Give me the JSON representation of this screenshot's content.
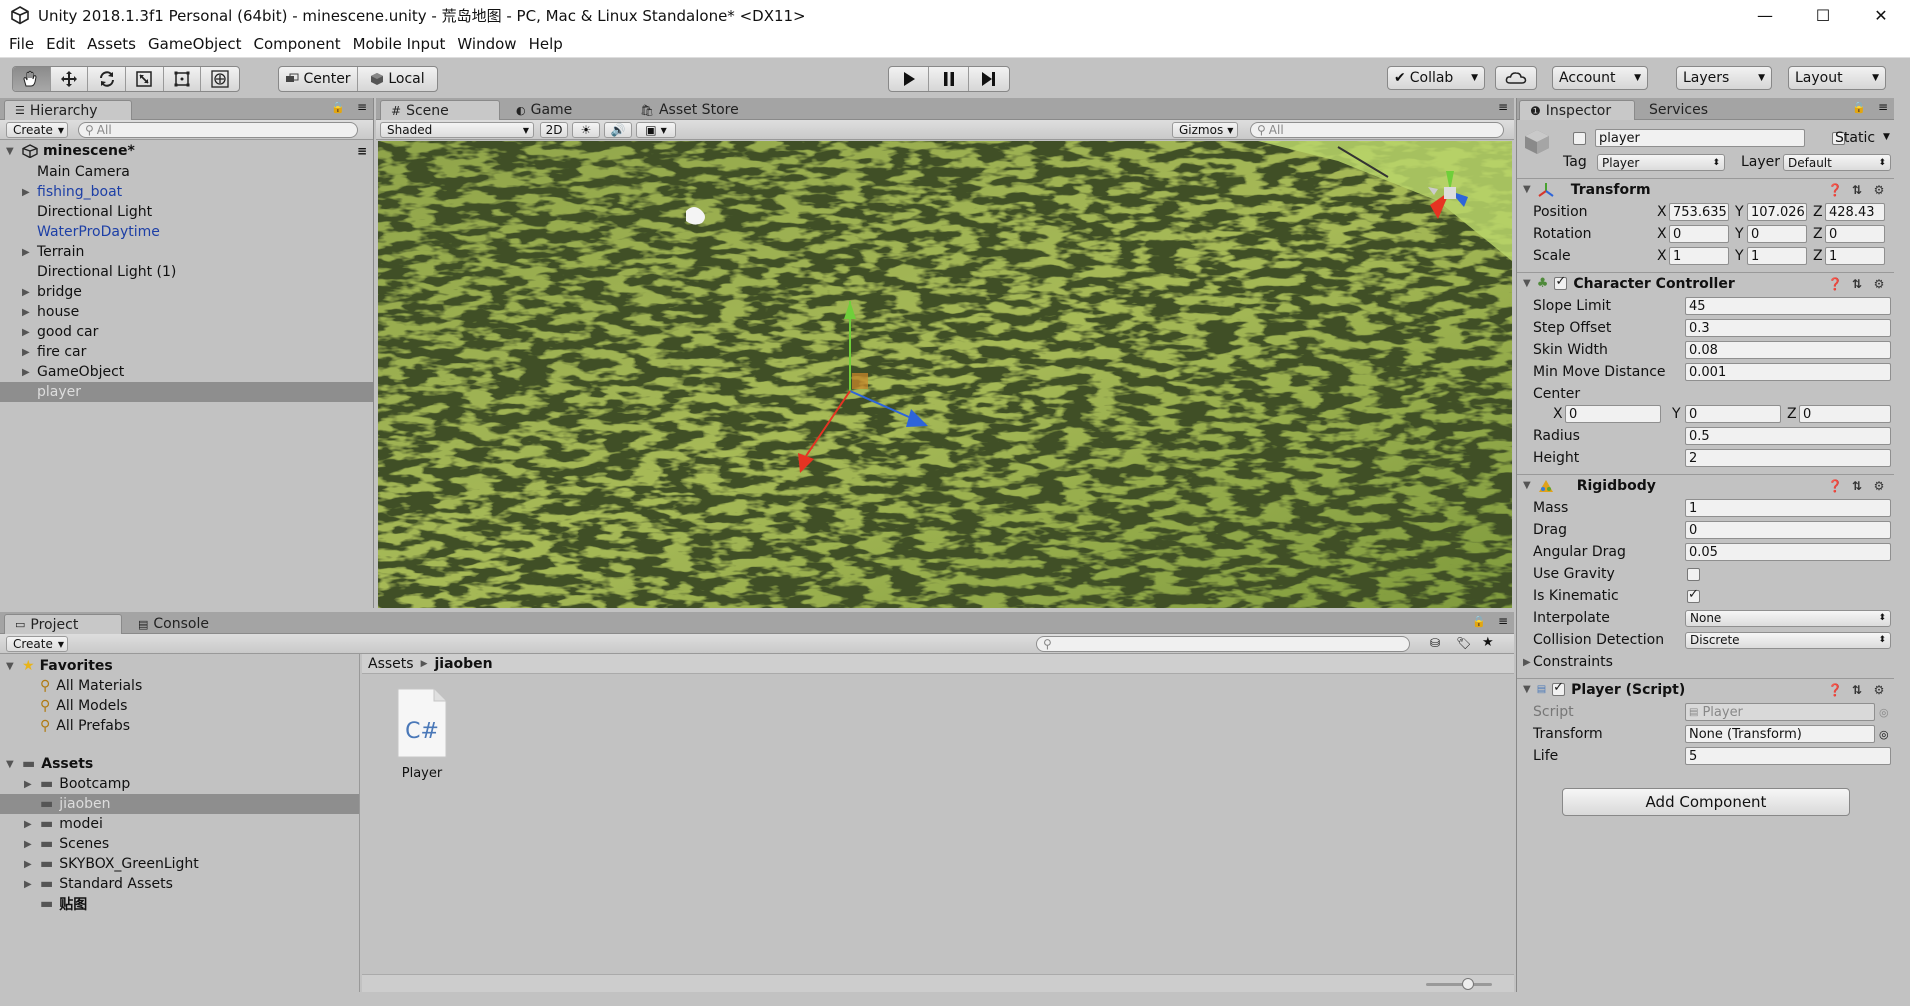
{
  "window": {
    "title": "Unity 2018.1.3f1 Personal (64bit) - minescene.unity - 荒岛地图 - PC, Mac & Linux Standalone* <DX11>",
    "controls": [
      "—",
      "☐",
      "✕"
    ]
  },
  "menu": [
    "File",
    "Edit",
    "Assets",
    "GameObject",
    "Component",
    "Mobile Input",
    "Window",
    "Help"
  ],
  "toolbar": {
    "pivot": "Center",
    "space": "Local",
    "collab": "Collab",
    "account": "Account",
    "layers": "Layers",
    "layout": "Layout"
  },
  "hierarchy": {
    "tab": "Hierarchy",
    "create": "Create",
    "search_placeholder": "All",
    "scene": "minescene*",
    "items": [
      {
        "label": "Main Camera",
        "children": false,
        "prefab": false
      },
      {
        "label": "fishing_boat",
        "children": true,
        "prefab": true
      },
      {
        "label": "Directional Light",
        "children": false,
        "prefab": false
      },
      {
        "label": "WaterProDaytime",
        "children": false,
        "prefab": true
      },
      {
        "label": "Terrain",
        "children": true,
        "prefab": false
      },
      {
        "label": "Directional Light (1)",
        "children": false,
        "prefab": false
      },
      {
        "label": "bridge",
        "children": true,
        "prefab": false
      },
      {
        "label": "house",
        "children": true,
        "prefab": false
      },
      {
        "label": "good car",
        "children": true,
        "prefab": false
      },
      {
        "label": "fire car",
        "children": true,
        "prefab": false
      },
      {
        "label": "GameObject",
        "children": true,
        "prefab": false
      },
      {
        "label": "player",
        "children": false,
        "prefab": false,
        "selected": true
      }
    ]
  },
  "scene_view": {
    "tabs": [
      "Scene",
      "Game",
      "Asset Store"
    ],
    "shading": "Shaded",
    "mode_2d": "2D",
    "gizmos": "Gizmos",
    "search_placeholder": "All"
  },
  "project": {
    "tabs": [
      "Project",
      "Console"
    ],
    "create": "Create",
    "favorites_label": "Favorites",
    "favorites": [
      "All Materials",
      "All Models",
      "All Prefabs"
    ],
    "assets_label": "Assets",
    "folders": [
      {
        "label": "Bootcamp",
        "children": true
      },
      {
        "label": "jiaoben",
        "children": false,
        "selected": true
      },
      {
        "label": "modei",
        "children": true
      },
      {
        "label": "Scenes",
        "children": true
      },
      {
        "label": "SKYBOX_GreenLight",
        "children": true
      },
      {
        "label": "Standard Assets",
        "children": true
      },
      {
        "label": "贴图",
        "children": false
      }
    ],
    "breadcrumb": [
      "Assets",
      "jiaoben"
    ],
    "files": [
      {
        "name": "Player",
        "type": "C#"
      }
    ]
  },
  "inspector": {
    "tabs": [
      "Inspector",
      "Services"
    ],
    "object_name": "player",
    "static_label": "Static",
    "tag_label": "Tag",
    "tag": "Player",
    "layer_label": "Layer",
    "layer": "Default",
    "transform": {
      "title": "Transform",
      "position_label": "Position",
      "rotation_label": "Rotation",
      "scale_label": "Scale",
      "position": [
        "753.635",
        "107.026",
        "428.43"
      ],
      "rotation": [
        "0",
        "0",
        "0"
      ],
      "scale": [
        "1",
        "1",
        "1"
      ]
    },
    "axis_labels": [
      "X",
      "Y",
      "Z"
    ],
    "character_controller": {
      "title": "Character Controller",
      "rows": [
        {
          "label": "Slope Limit",
          "value": "45"
        },
        {
          "label": "Step Offset",
          "value": "0.3"
        },
        {
          "label": "Skin Width",
          "value": "0.08"
        },
        {
          "label": "Min Move Distance",
          "value": "0.001"
        }
      ],
      "center_label": "Center",
      "center": [
        "0",
        "0",
        "0"
      ],
      "radius_label": "Radius",
      "radius": "0.5",
      "height_label": "Height",
      "height": "2"
    },
    "rigidbody": {
      "title": "Rigidbody",
      "rows": [
        {
          "label": "Mass",
          "value": "1"
        },
        {
          "label": "Drag",
          "value": "0"
        },
        {
          "label": "Angular Drag",
          "value": "0.05"
        }
      ],
      "use_gravity_label": "Use Gravity",
      "use_gravity": false,
      "is_kinematic_label": "Is Kinematic",
      "is_kinematic": true,
      "interpolate_label": "Interpolate",
      "interpolate": "None",
      "collision_label": "Collision Detection",
      "collision": "Discrete",
      "constraints_label": "Constraints"
    },
    "player_script": {
      "title": "Player (Script)",
      "script_label": "Script",
      "script": "Player",
      "transform_label": "Transform",
      "transform": "None (Transform)",
      "life_label": "Life",
      "life": "5"
    },
    "add_component": "Add Component"
  },
  "colors": {
    "panel": "#c2c2c2",
    "tabbar": "#a4a4a4",
    "selection": "#8e8e8e",
    "prefab_blue": "#1d3fa6",
    "gizmo_y": "#6fcf3a",
    "gizmo_x": "#e63322",
    "gizmo_z": "#2e65d9"
  }
}
